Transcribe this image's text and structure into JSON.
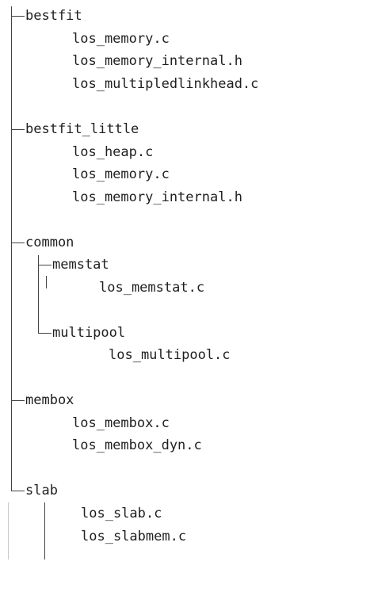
{
  "tree": [
    {
      "name": "bestfit",
      "files": [
        "los_memory.c",
        "los_memory_internal.h",
        "los_multipledlinkhead.c"
      ]
    },
    {
      "name": "bestfit_little",
      "files": [
        "los_heap.c",
        "los_memory.c",
        "los_memory_internal.h"
      ]
    },
    {
      "name": "common",
      "children": [
        {
          "name": "memstat",
          "files": [
            "los_memstat.c"
          ]
        },
        {
          "name": "multipool",
          "files": [
            "los_multipool.c"
          ]
        }
      ]
    },
    {
      "name": "membox",
      "files": [
        "los_membox.c",
        "los_membox_dyn.c"
      ]
    },
    {
      "name": "slab",
      "files": [
        "los_slab.c",
        "los_slabmem.c"
      ]
    }
  ]
}
